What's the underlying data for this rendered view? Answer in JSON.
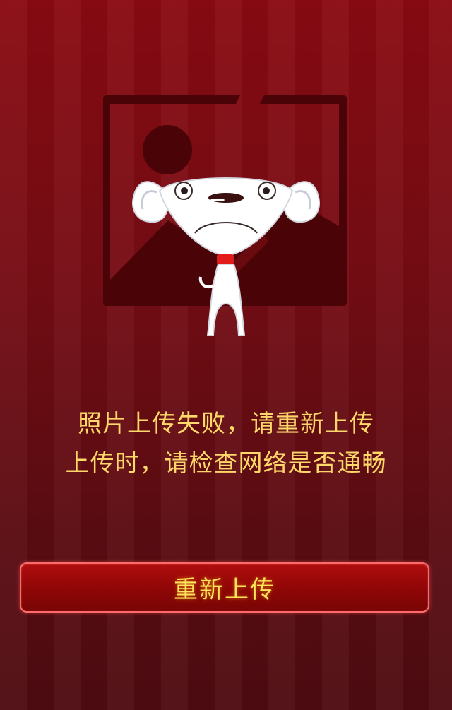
{
  "illustration": {
    "name": "failed-photo-mascot",
    "icon": "broken-image-icon"
  },
  "message": {
    "line1": "照片上传失败，请重新上传",
    "line2": "上传时，请检查网络是否通畅"
  },
  "button": {
    "label": "重新上传"
  },
  "colors": {
    "background": "#7a0b13",
    "text": "#ffd86a",
    "button_text": "#ffe35a",
    "button_bg": "#9a0808",
    "button_border": "#ff6a6a"
  }
}
